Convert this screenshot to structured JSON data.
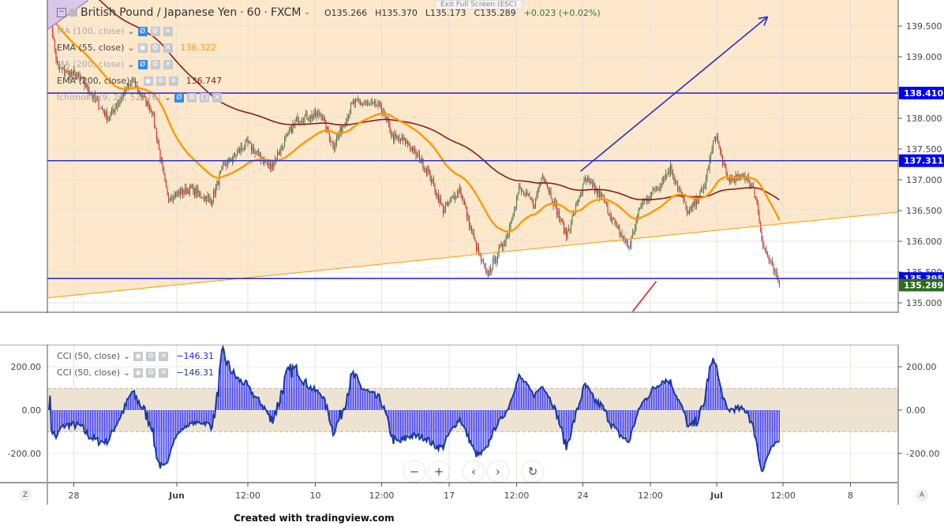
{
  "header": {
    "symbol": "British Pound / Japanese Yen",
    "interval": "60",
    "exchange": "FXCM",
    "open": "O135.266",
    "high": "H135.370",
    "low": "L135.173",
    "close": "C135.289",
    "change": "+0.023 (+0.02%)",
    "exit_fullscreen": "Exit Full Screen (ESC)"
  },
  "indicators": [
    {
      "label": "MA (100, close)",
      "value": "",
      "hidden": true
    },
    {
      "label": "EMA (55, close)",
      "value": "136.322",
      "color": "#ff9800"
    },
    {
      "label": "MA (200, close)",
      "value": "",
      "hidden": true
    },
    {
      "label": "EMA (200, close)",
      "value": "136.747",
      "color": "#8b1a1a"
    },
    {
      "label": "Ichimoku (9, 26, 52, 26)",
      "value": "",
      "hidden": true
    }
  ],
  "cci_legend": [
    {
      "label": "CCI (50, close)",
      "value": "−146.31"
    },
    {
      "label": "CCI (50, close)",
      "value": "−146.31"
    }
  ],
  "footer": "Created with tradingview.com",
  "corner_left": "Z",
  "corner_right": "A",
  "nav": {
    "zoom_out": "−",
    "zoom_in": "+",
    "back": "‹",
    "forward": "›",
    "reset": "↻"
  },
  "chart_data": {
    "type": "candlestick",
    "price_ticks": [
      "139.500",
      "139.000",
      "138.000",
      "137.500",
      "137.000",
      "136.500",
      "136.000",
      "135.500",
      "135.000"
    ],
    "price_tick_values": [
      139.5,
      139.0,
      138.0,
      137.5,
      137.0,
      136.5,
      136.0,
      135.5,
      135.0
    ],
    "price_range": [
      134.85,
      139.92
    ],
    "price_labels": [
      {
        "text": "138.410",
        "value": 138.41,
        "color": "#0000ff"
      },
      {
        "text": "137.311",
        "value": 137.311,
        "color": "#0000ff"
      },
      {
        "text": "135.395",
        "value": 135.395,
        "color": "#0000ff"
      },
      {
        "text": "135.289",
        "value": 135.289,
        "color": "#2e6b1f"
      }
    ],
    "horizontal_lines": [
      138.41,
      137.311,
      135.395
    ],
    "trendline": {
      "from": [
        0,
        135.08
      ],
      "to": [
        719,
        136.48
      ],
      "color": "#ff9800"
    },
    "arrow": {
      "from": [
        449,
        137.14
      ],
      "to": [
        607,
        139.65
      ],
      "color": "#2d2dc8"
    },
    "red_line": {
      "from": [
        493,
        134.86
      ],
      "to": [
        513,
        135.35
      ]
    },
    "purple_line": {
      "from": [
        0,
        139.45
      ],
      "to": [
        33,
        139.92
      ]
    },
    "bars_total": 719,
    "close_keypoints": [
      [
        1,
        139.67
      ],
      [
        7,
        138.83
      ],
      [
        27,
        138.64
      ],
      [
        50,
        138.0
      ],
      [
        70,
        138.6
      ],
      [
        87,
        138.13
      ],
      [
        100,
        136.72
      ],
      [
        120,
        136.85
      ],
      [
        137,
        136.65
      ],
      [
        147,
        137.2
      ],
      [
        167,
        137.6
      ],
      [
        187,
        137.2
      ],
      [
        210,
        138.0
      ],
      [
        230,
        138.06
      ],
      [
        240,
        137.55
      ],
      [
        257,
        138.25
      ],
      [
        280,
        138.2
      ],
      [
        290,
        137.7
      ],
      [
        303,
        137.6
      ],
      [
        320,
        137.15
      ],
      [
        333,
        136.5
      ],
      [
        347,
        136.85
      ],
      [
        360,
        135.95
      ],
      [
        370,
        135.44
      ],
      [
        387,
        136.1
      ],
      [
        397,
        136.85
      ],
      [
        410,
        136.6
      ],
      [
        417,
        137.1
      ],
      [
        437,
        136.1
      ],
      [
        453,
        137.0
      ],
      [
        467,
        136.72
      ],
      [
        480,
        136.2
      ],
      [
        490,
        135.9
      ],
      [
        500,
        136.6
      ],
      [
        513,
        136.85
      ],
      [
        525,
        137.2
      ],
      [
        540,
        136.45
      ],
      [
        553,
        136.85
      ],
      [
        563,
        137.75
      ],
      [
        573,
        137.0
      ],
      [
        590,
        137.05
      ],
      [
        597,
        136.72
      ],
      [
        603,
        135.95
      ],
      [
        617,
        135.289
      ]
    ],
    "ema_periods": [
      55,
      200
    ],
    "cci": {
      "period": 50,
      "ticks": [
        "200.00",
        "0.00",
        "-200.00"
      ],
      "tick_values": [
        200,
        0,
        -200
      ],
      "band": [
        -100,
        100
      ],
      "range": [
        -340,
        290
      ]
    },
    "time_ticks": [
      {
        "text": "28",
        "bar": 21
      },
      {
        "text": "Jun",
        "bar": 108,
        "bold": true
      },
      {
        "text": "12:00",
        "bar": 168
      },
      {
        "text": "10",
        "bar": 225
      },
      {
        "text": "12:00",
        "bar": 281
      },
      {
        "text": "17",
        "bar": 338
      },
      {
        "text": "12:00",
        "bar": 395
      },
      {
        "text": "24",
        "bar": 451
      },
      {
        "text": "12:00",
        "bar": 508
      },
      {
        "text": "Jul",
        "bar": 564,
        "bold": true
      },
      {
        "text": "12:00",
        "bar": 620
      },
      {
        "text": "8",
        "bar": 677
      }
    ]
  }
}
